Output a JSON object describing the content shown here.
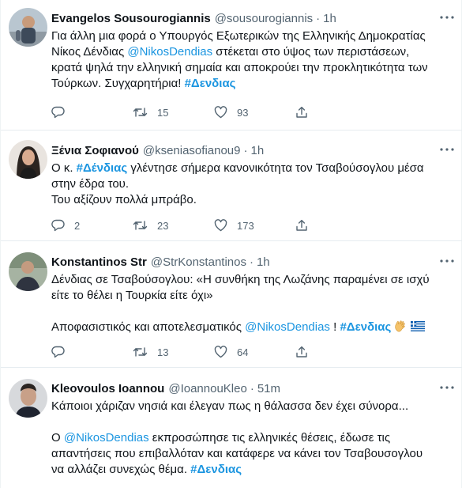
{
  "tweets": [
    {
      "name": "Evangelos Sousourogiannis",
      "handle": "@sousourogiannis",
      "dot": "·",
      "time": "1h",
      "lines": [
        {
          "pre": "Για άλλη μια φορά ο Υπουργός Εξωτερικών της Ελληνικής Δημοκρατίας"
        },
        {
          "pre": "Νίκος Δένδιας ",
          "mention": "@NikosDendias",
          "post": " στέκεται στο ύψος των περιστάσεων,"
        },
        {
          "pre": "κρατά ψηλά την ελληνική σημαία και αποκρούει την προκλητικότητα των"
        },
        {
          "pre": "Τούρκων. Συγχαρητήρια! ",
          "hashtag": "#Δενδιας"
        }
      ],
      "replies": "",
      "retweets": "15",
      "likes": "93"
    },
    {
      "name": "Ξένια Σοφιανού",
      "handle": "@kseniasofianou9",
      "dot": "·",
      "time": "1h",
      "lines": [
        {
          "pre": "Ο κ. ",
          "hashtag": "#Δένδιας",
          "post": " γλέντησε σήμερα  κανονικότητα τον Τσαβούσογλου μέσα"
        },
        {
          "pre": "στην έδρα του."
        },
        {
          "pre": "Του αξίζουν πολλά μπράβο."
        }
      ],
      "replies": "2",
      "retweets": "23",
      "likes": "173"
    },
    {
      "name": "Konstantinos Str",
      "handle": "@StrKonstantinos",
      "dot": "·",
      "time": "1h",
      "lines": [
        {
          "pre": "Δένδιας σε Τσαβούσογλου: «Η συνθήκη της Λωζάνης παραμένει σε ισχύ"
        },
        {
          "pre": "είτε το θέλει η Τουρκία είτε όχι»"
        },
        {
          "pre": ""
        },
        {
          "pre": "Αποφασιστικός και αποτελεσματικός ",
          "mention": "@NikosDendias",
          "post": " ! ",
          "hashtag": "#Δενδιας",
          "emoji": true
        }
      ],
      "replies": "",
      "retweets": "13",
      "likes": "64"
    },
    {
      "name": "Kleovoulos Ioannou",
      "handle": "@IoannouKleo",
      "dot": "·",
      "time": "51m",
      "lines": [
        {
          "pre": "Κάποιοι χάριζαν νησιά και έλεγαν πως η θάλασσα δεν έχει σύνορα..."
        },
        {
          "pre": ""
        },
        {
          "pre": "Ο ",
          "mention": "@NikosDendias",
          "post": " εκπροσώπησε τις ελληνικές θέσεις, έδωσε τις"
        },
        {
          "pre": "απαντήσεις που επιβαλλόταν και κατάφερε να κάνει τον Τσαβουσογλου"
        },
        {
          "pre": "να αλλάζει συνεχώς θέμα. ",
          "hashtag": "#Δενδιας"
        }
      ],
      "replies": "",
      "retweets": "",
      "likes": ""
    }
  ],
  "icons": {
    "reply": "reply-icon",
    "retweet": "retweet-icon",
    "like": "heart-icon",
    "share": "share-icon",
    "more": "more-options-icon"
  },
  "colors": {
    "link": "#1b95e0",
    "secondary": "#536471",
    "divider": "#e6ecf0"
  }
}
